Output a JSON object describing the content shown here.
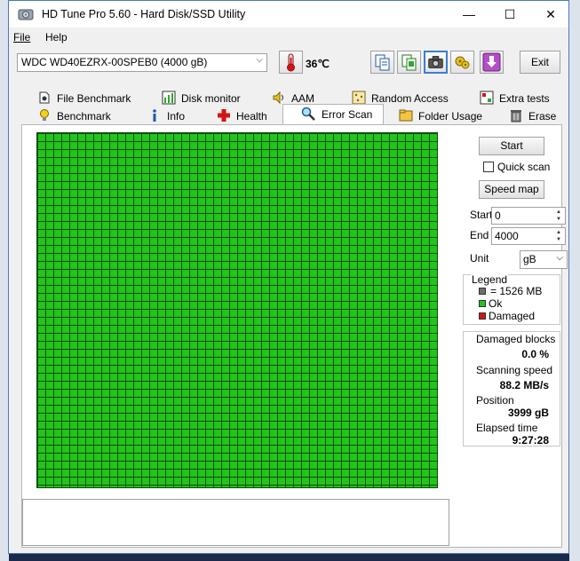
{
  "window": {
    "title": "HD Tune Pro 5.60 - Hard Disk/SSD Utility"
  },
  "titlebar_buttons": {
    "minimize": "—",
    "maximize": "☐",
    "close": "✕"
  },
  "menu": {
    "file": "File",
    "help": "Help"
  },
  "toolbar": {
    "drive": "WDC WD40EZRX-00SPEB0 (4000 gB)",
    "temperature": "36℃",
    "exit": "Exit",
    "icons": [
      "copy-text-icon",
      "copy-screenshot-icon",
      "camera-icon",
      "options-icon",
      "save-download-icon"
    ]
  },
  "tabs": {
    "row1": [
      "File Benchmark",
      "Disk monitor",
      "AAM",
      "Random Access",
      "Extra tests"
    ],
    "row2": [
      "Benchmark",
      "Info",
      "Health",
      "Error Scan",
      "Folder Usage",
      "Erase"
    ],
    "active": "Error Scan"
  },
  "controls": {
    "start_button": "Start",
    "quick_scan": "Quick scan",
    "speed_map": "Speed map",
    "start_label": "Start",
    "start_value": "0",
    "end_label": "End",
    "end_value": "4000",
    "unit_label": "Unit",
    "unit_value": "gB"
  },
  "legend": {
    "title": "Legend",
    "block_size": "= 1526 MB",
    "ok": "Ok",
    "damaged": "Damaged"
  },
  "stats": {
    "damaged_blocks_label": "Damaged blocks",
    "damaged_blocks_value": "0.0 %",
    "scanning_speed_label": "Scanning speed",
    "scanning_speed_value": "88.2 MB/s",
    "position_label": "Position",
    "position_value": "3999 gB",
    "elapsed_time_label": "Elapsed time",
    "elapsed_time_value": "9:27:28"
  },
  "colors": {
    "ok": "#22c41a",
    "damaged": "#d41414",
    "block": "#6e6e6e",
    "grid_lines": "#0b4d0b"
  }
}
